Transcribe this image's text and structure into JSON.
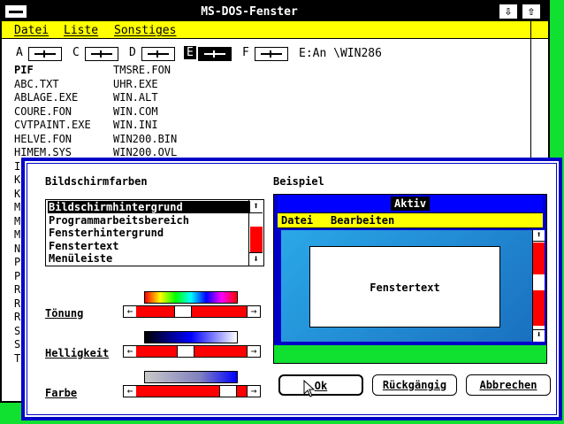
{
  "window": {
    "title": "MS-DOS-Fenster",
    "minimize_icon": "down-arrow-icon",
    "maximize_icon": "up-arrow-icon"
  },
  "menubar": {
    "datei": "Datei",
    "liste": "Liste",
    "sonstiges": "Sonstiges"
  },
  "drives": {
    "a": "A",
    "c": "C",
    "d": "D",
    "e": "E",
    "f": "F",
    "selected": "E",
    "path": "E:An \\WIN286"
  },
  "files": {
    "col1": [
      "PIF",
      "ABC.TXT",
      "ABLAGE.EXE",
      "COURE.FON",
      "CVTPAINT.EXE",
      "HELVE.FON",
      "HIMEM.SYS",
      "I",
      "K",
      "K",
      "M",
      "M",
      "M",
      "N",
      "P",
      "P",
      "R",
      "R",
      "R",
      "S",
      "S",
      "T"
    ],
    "col2": [
      "TMSRE.FON",
      "UHR.EXE",
      "WIN.ALT",
      "WIN.COM",
      "WIN.INI",
      "WIN200.BIN",
      "WIN200.OVL"
    ]
  },
  "dialog": {
    "title": "Bildschirmfarben",
    "list_items": [
      "Bildschirmhintergrund",
      "Programmarbeitsbereich",
      "Fensterhintergrund",
      "Fenstertext",
      "Menüleiste"
    ],
    "selected_item": "Bildschirmhintergrund",
    "hue_label": "Tönung",
    "brightness_label": "Helligkeit",
    "color_label": "Farbe",
    "hue_value": 0.4,
    "brightness_value": 0.43,
    "color_value": 0.87,
    "sample_label": "Beispiel",
    "sample_active_title": "Aktiv",
    "sample_menu_datei": "Datei",
    "sample_menu_bearbeiten": "Bearbeiten",
    "sample_window_text": "Fenstertext",
    "ok_button": "Ok",
    "undo_button": "Rückgängig",
    "cancel_button": "Abbrechen"
  },
  "colors": {
    "desktop": "#10e030",
    "accent_blue": "#0000c8",
    "menubar_yellow": "#ffff00",
    "slider_red": "#ff0000"
  }
}
